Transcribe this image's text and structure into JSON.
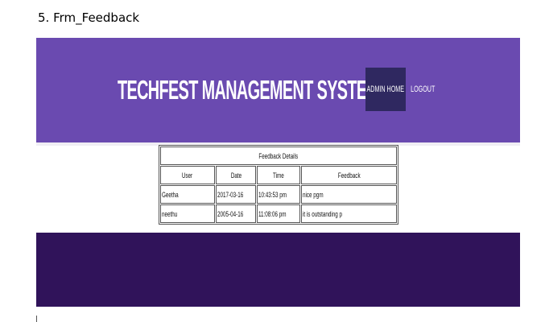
{
  "doc_heading": "5. Frm_Feedback",
  "header": {
    "title": "TECHFEST MANAGEMENT SYSTEM",
    "nav": {
      "admin_home": "ADMIN HOME",
      "logout": "LOGOUT"
    }
  },
  "colors": {
    "header_bg": "#6a4ab0",
    "active_nav_bg": "#2f2860",
    "footer_bg": "#30135a"
  },
  "feedback": {
    "caption": "Feedback Details",
    "columns": [
      "User",
      "Date",
      "Time",
      "Feedback"
    ],
    "rows": [
      [
        "Geetha",
        "2017-03-16",
        "10:43:53 pm",
        "nice pgm"
      ],
      [
        "neethu",
        "2005-04-16",
        "11:08:06 pm",
        "it is outstanding p"
      ]
    ]
  }
}
